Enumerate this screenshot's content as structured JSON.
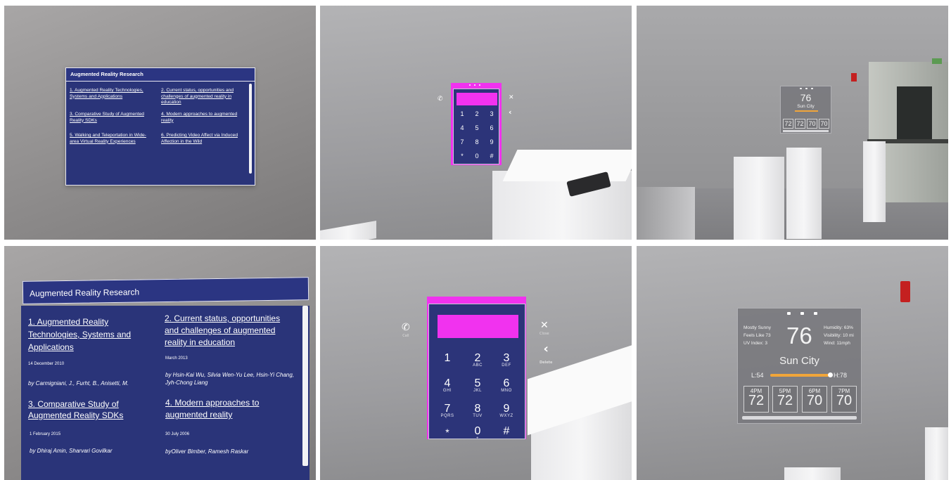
{
  "ar_research": {
    "title": "Augmented Reality Research",
    "papers": [
      {
        "title": "1. Augmented Reality Technologies, Systems and Applications",
        "date": "14 December 2010",
        "authors": "by Carmigniani, J., Furht, B., Anisetti, M."
      },
      {
        "title": "2. Current status, opportunities and challenges of augmented reality in education",
        "date": "March 2013",
        "authors": "by Hsin-Kai Wu, Silvia Wen-Yu Lee, Hsin-Yi Chang, Jyh-Chong Liang"
      },
      {
        "title": "3. Comparative Study of Augmented Reality SDKs",
        "date": "1 February 2015",
        "authors": "by Dhiraj Amin, Sharvari Govilkar"
      },
      {
        "title": "4. Modern approaches to augmented reality",
        "date": "30 July 2006",
        "authors": "byOliver Bimber, Ramesh Raskar"
      },
      {
        "title": "5. Walking and Teleportation in Wide-area Virtual Reality Experiences"
      },
      {
        "title": "6. Predicting Video Affect via Induced Affection in the Wild"
      }
    ]
  },
  "dialer": {
    "keys": [
      {
        "digit": "1",
        "letters": ""
      },
      {
        "digit": "2",
        "letters": "ABC"
      },
      {
        "digit": "3",
        "letters": "DEF"
      },
      {
        "digit": "4",
        "letters": "GHI"
      },
      {
        "digit": "5",
        "letters": "JKL"
      },
      {
        "digit": "6",
        "letters": "MNO"
      },
      {
        "digit": "7",
        "letters": "PQRS"
      },
      {
        "digit": "8",
        "letters": "TUV"
      },
      {
        "digit": "9",
        "letters": "WXYZ"
      },
      {
        "digit": "*",
        "letters": ""
      },
      {
        "digit": "0",
        "letters": "+"
      },
      {
        "digit": "#",
        "letters": ""
      }
    ],
    "call_icon": "phone-icon",
    "close_icon": "close-icon",
    "back_icon": "backspace-chevron-icon",
    "call_caption": "Call",
    "close_caption": "Close",
    "back_caption": "Delete",
    "accent_color": "#f132ef",
    "panel_color": "#2c3479"
  },
  "weather": {
    "condition": "Mostly Sunny",
    "feels_like": "Feels Like 73",
    "uv_index": "UV Index: 3",
    "temperature": "76",
    "humidity": "Humidity: 63%",
    "visibility": "Visibility: 10 mi",
    "wind": "Wind: 11mph",
    "city": "Sun City",
    "low": "L:54",
    "high": "H:78",
    "hourly": [
      {
        "hour": "4PM",
        "temp": "72"
      },
      {
        "hour": "5PM",
        "temp": "72"
      },
      {
        "hour": "6PM",
        "temp": "70"
      },
      {
        "hour": "7PM",
        "temp": "70"
      }
    ],
    "range_color": "#f0a53a"
  }
}
